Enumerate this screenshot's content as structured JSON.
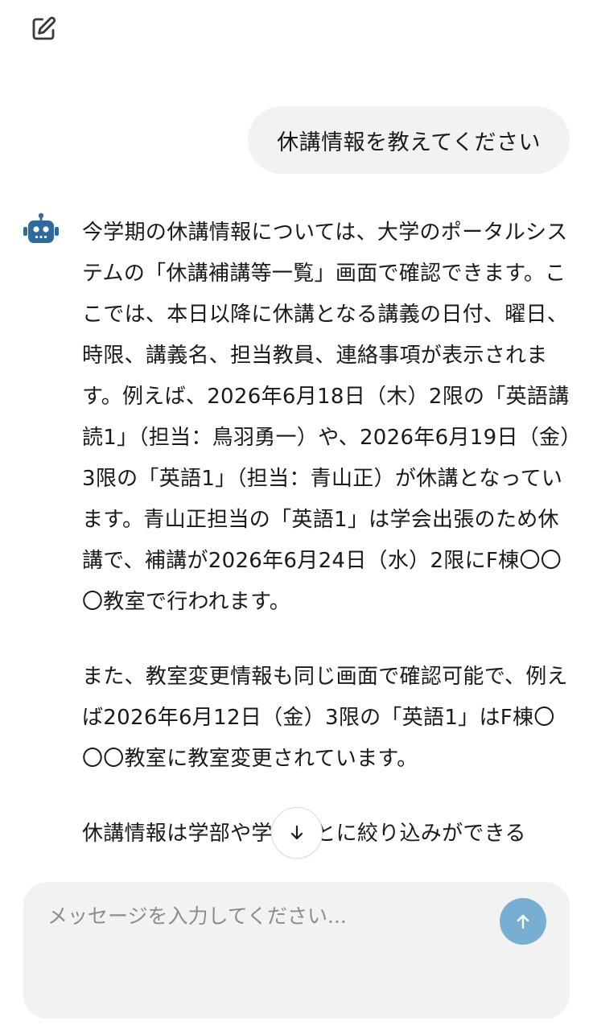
{
  "header": {
    "new_chat_icon": "edit-icon"
  },
  "messages": {
    "user": {
      "text": "休講情報を教えてください"
    },
    "assistant": {
      "avatar_icon": "robot-icon",
      "avatar_color": "#2f6a9c",
      "paragraphs": [
        "今学期の休講情報については、大学のポータルシステムの「休講補講等一覧」画面で確認できます。ここでは、本日以降に休講となる講義の日付、曜日、時限、講義名、担当教員、連絡事項が表示されます。例えば、2026年6月18日（木）2限の「英語講読1」（担当：鳥羽勇一）や、2026年6月19日（金）3限の「英語1」（担当：青山正）が休講となっています。青山正担当の「英語1」は学会出張のため休講で、補講が2026年6月24日（水）2限にF棟〇〇〇教室で行われます。",
        "また、教室変更情報も同じ画面で確認可能で、例えば2026年6月12日（金）3限の「英語1」はF棟〇〇〇教室に教室変更されています。",
        "休講情報は学部や学科ごとに絞り込みができる"
      ]
    }
  },
  "scroll_button": {
    "icon": "arrow-down-icon"
  },
  "composer": {
    "placeholder": "メッセージを入力してください...",
    "value": "",
    "send_icon": "arrow-up-icon",
    "send_color": "#79aed3"
  }
}
